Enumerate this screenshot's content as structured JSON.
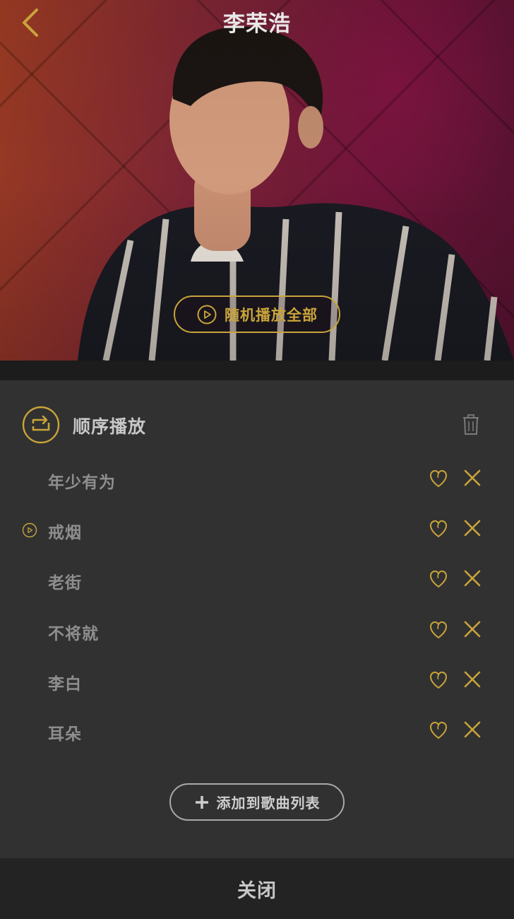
{
  "header": {
    "title": "李荣浩",
    "back_icon": "chevron-left-icon",
    "shuffle_all_label": "随机播放全部",
    "shuffle_icon": "play-circle-icon"
  },
  "playlist": {
    "mode_label": "顺序播放",
    "mode_icon": "repeat-sequence-icon",
    "clear_icon": "trash-icon",
    "songs": [
      {
        "title": "年少有为",
        "playing": false
      },
      {
        "title": "戒烟",
        "playing": true
      },
      {
        "title": "老街",
        "playing": false
      },
      {
        "title": "不将就",
        "playing": false
      },
      {
        "title": "李白",
        "playing": false
      },
      {
        "title": "耳朵",
        "playing": false
      }
    ],
    "favorite_icon": "heart-icon",
    "remove_icon": "close-icon",
    "add_label": "添加到歌曲列表",
    "add_icon": "plus-icon"
  },
  "footer": {
    "close_label": "关闭"
  },
  "colors": {
    "accent": "#c9a43a",
    "panel_bg": "#313131",
    "footer_bg": "#232323",
    "song_text": "#8e8e8e"
  }
}
